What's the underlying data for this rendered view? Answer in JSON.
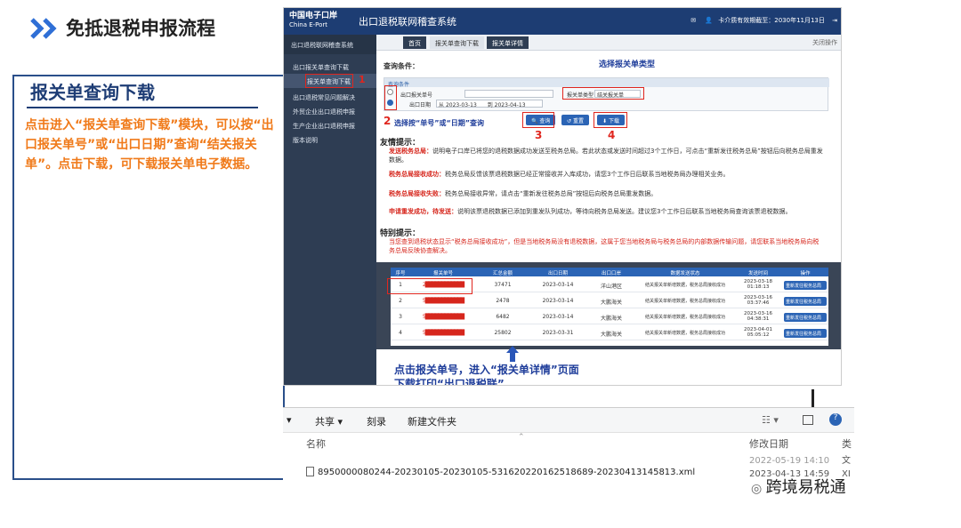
{
  "slide": {
    "title": "免抵退税申报流程",
    "panel_heading": "报关单查询下载",
    "description": "点击进入“报关单查询下载”模块，可以按“出口报关单号”或“出口日期”查询“结关报关单”。点击下载，可下载报关单电子数据。",
    "watermark": "跨境易税通"
  },
  "app": {
    "logo_cn": "中国电子口岸",
    "logo_en": "China E-Port",
    "system_name": "出口退税联网稽查系统",
    "cert_info": "卡介质有效期截至：2030年11月13日",
    "sidebar": {
      "header": "出口退税联网稽查系统",
      "items": [
        "出口报关单查询下载",
        "报关单查询下载",
        "出口退税常见问题解决",
        "外贸企业出口退税申报",
        "生产企业出口退税申报",
        "版本说明"
      ]
    },
    "tabs": [
      "首页",
      "报关单查询下载",
      "报关单详情"
    ],
    "close_ops": "关闭操作",
    "query": {
      "label": "查询条件：",
      "box_title": "查询条件",
      "field_number": "出口报关单号",
      "field_date": "出口日期",
      "date_from_prefix": "从",
      "date_from": "2023-03-13",
      "date_to_prefix": "到",
      "date_to": "2023-04-13",
      "type_label": "报关单类型",
      "type_value": "结关报关单",
      "btn_query": "查询",
      "btn_reset": "重置",
      "btn_download": "下载"
    },
    "tips": {
      "title": "友情提示：",
      "rows": [
        {
          "key": "发送税务总局：",
          "text": "说明电子口岸已将您的退税数据成功发送至税务总局。若此状态或发送时间超过3个工作日，可点击“重新发往税务总局”按钮后向税务总局重发数据。"
        },
        {
          "key": "税务总局接收成功：",
          "text": "税务总局反馈该票退税数据已经正常接收并入库成功，请您3个工作日后联系当地税务局办理相关业务。"
        },
        {
          "key": "税务总局接收失败：",
          "text": "税务总局接收异常，请点击“重新发往税务总局”按钮后向税务总局重发数据。"
        },
        {
          "key": "申请重发成功，待发送：",
          "text": "说明该票退税数据已添加到重发队列成功，等待向税务总局发送。建议您3个工作日后联系当地税务局查询该票退税数据。"
        }
      ],
      "special_title": "特别提示：",
      "special_text": "当您查到退税状态显示“税务总局接收成功”，但是当地税务局没有退税数据，这属于您当地税务局与税务总局的内部数据传输问题，请您联系当地税务局向税务总局反映协查解决。"
    },
    "table": {
      "headers": [
        "序号",
        "报关单号",
        "汇总金额",
        "出口日期",
        "出口口岸",
        "数据发送状态",
        "发送时间",
        "操作"
      ],
      "rows": [
        {
          "idx": "1",
          "no": "2████████████",
          "amount": "37471",
          "date": "2023-03-14",
          "port": "洋山港区",
          "status": "结关报关单新增数据，税务总局接收成功",
          "time": "2023-03-18 01:18:13",
          "op": "重新发往税务总局"
        },
        {
          "idx": "2",
          "no": "5████████████",
          "amount": "2478",
          "date": "2023-03-14",
          "port": "大鹏海关",
          "status": "结关报关单新增数据，税务总局接收成功",
          "time": "2023-03-16 03:37:46",
          "op": "重新发往税务总局"
        },
        {
          "idx": "3",
          "no": "5████████████",
          "amount": "6482",
          "date": "2023-03-14",
          "port": "大鹏海关",
          "status": "结关报关单新增数据，税务总局接收成功",
          "time": "2023-03-16 04:38:31",
          "op": "重新发往税务总局"
        },
        {
          "idx": "4",
          "no": "5████████████",
          "amount": "25802",
          "date": "2023-03-31",
          "port": "大鹏海关",
          "status": "结关报关单新增数据，税务总局接收成功",
          "time": "2023-04-01 05:05:12",
          "op": "重新发往税务总局"
        }
      ]
    },
    "annotations": {
      "n1": "1",
      "n2": "2",
      "n3": "3",
      "n4": "4",
      "choose_type": "选择报关单类型",
      "choose_query": "选择按“单号”或“日期”查询",
      "click_detail": "点击报关单号，进入“报关单详情”页面",
      "print_text": "下载打印“出口退税联”"
    }
  },
  "explorer": {
    "toolbar": [
      "共享",
      "刻录",
      "新建文件夹"
    ],
    "col_name": "名称",
    "col_date": "修改日期",
    "col_type": "类",
    "file_name": "8950000080244-20230105-20230105-531620220162518689-20230413145813.xml",
    "dates": [
      "2022-05-19 14:10",
      "2023-04-13 14:59"
    ],
    "type_trunc": [
      "文",
      "XI"
    ]
  },
  "colors": {
    "accent_blue": "#1e3d75",
    "orange": "#f07a1a",
    "red_annotation": "#e0261e",
    "app_header": "#1d3d73",
    "sidebar": "#2e3d53"
  }
}
